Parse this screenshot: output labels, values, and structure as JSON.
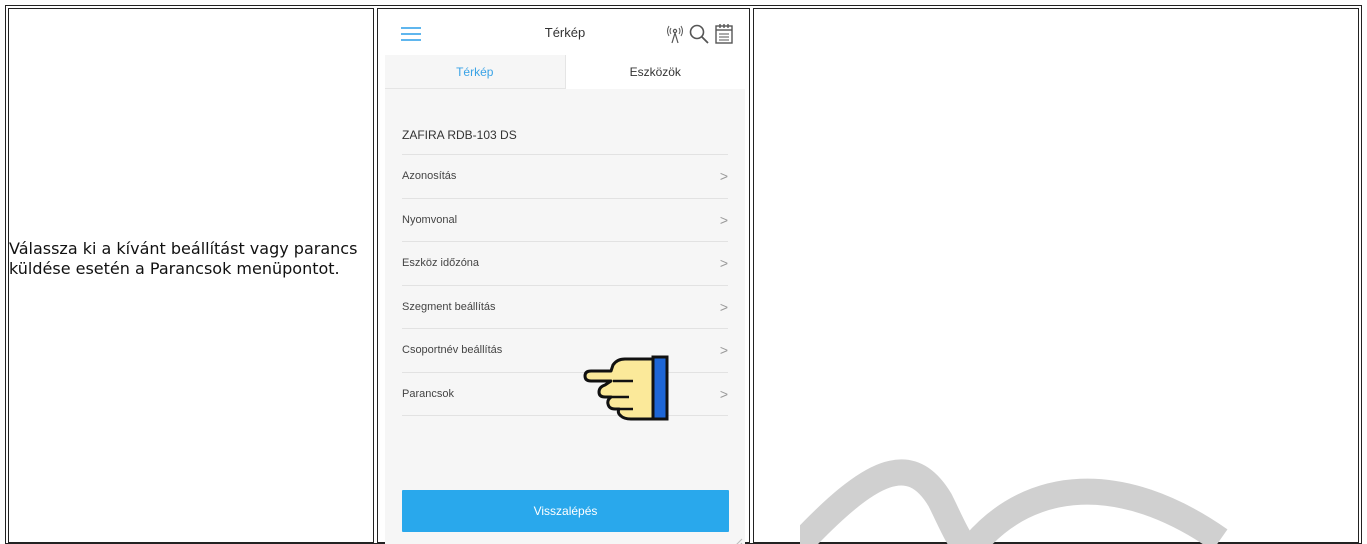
{
  "instruction": {
    "text": "Válassza ki a kívánt beállítást vagy parancs küldése esetén a Parancsok menüpontot."
  },
  "app": {
    "header": {
      "title": "Térkép",
      "icons": [
        "hamburger-menu-icon",
        "antenna-icon",
        "search-icon",
        "calendar-icon"
      ]
    },
    "tabs": [
      {
        "label": "Térkép",
        "active": true
      },
      {
        "label": "Eszközök",
        "active": false
      }
    ],
    "device_name": "ZAFIRA RDB-103 DS",
    "menu_items": [
      {
        "label": "Azonosítás"
      },
      {
        "label": "Nyomvonal"
      },
      {
        "label": "Eszköz időzóna"
      },
      {
        "label": "Szegment beállítás"
      },
      {
        "label": "Csoportnév beállítás"
      },
      {
        "label": "Parancsok"
      }
    ],
    "chevron": ">",
    "back_button": "Visszalépés",
    "colors": {
      "accent": "#29a8ec",
      "tab_active": "#3aa3e6",
      "pointer_hand": "#fbe99a",
      "pointer_cuff": "#1e66d6"
    }
  }
}
